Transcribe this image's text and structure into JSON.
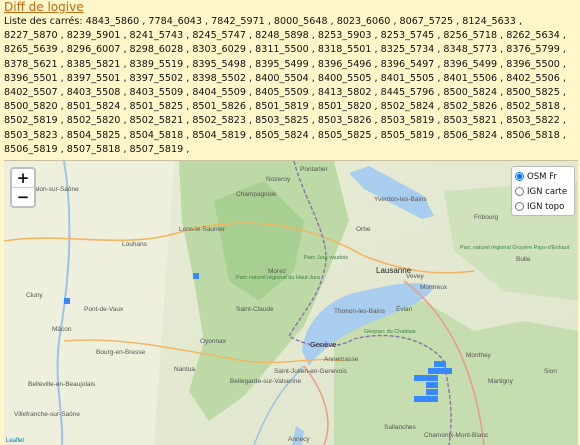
{
  "header": {
    "title": "Diff de logive",
    "list_prefix": "Liste des carrés:",
    "list_text": "Liste des carrés: 4843_5860 , 7784_6043 , 7842_5971 , 8000_5648 , 8023_6060 , 8067_5725 , 8124_5633 , 8227_5870 , 8239_5901 , 8241_5743 , 8245_5747 , 8248_5898 , 8253_5903 , 8253_5745 , 8256_5718 , 8262_5634 , 8265_5639 , 8296_6007 , 8298_6028 , 8303_6029 , 8311_5500 , 8318_5501 , 8325_5734 , 8348_5773 , 8376_5799 , 8378_5621 , 8385_5821 , 8389_5519 , 8395_5498 , 8395_5499 , 8396_5496 , 8396_5497 , 8396_5499 , 8396_5500 , 8396_5501 , 8397_5501 , 8397_5502 , 8398_5502 , 8400_5504 , 8400_5505 , 8401_5505 , 8401_5506 , 8402_5506 , 8402_5507 , 8403_5508 , 8403_5509 , 8404_5509 , 8405_5509 , 8413_5802 , 8445_5796 , 8500_5824 , 8500_5825 , 8500_5820 , 8501_5824 , 8501_5825 , 8501_5826 , 8501_5819 , 8501_5820 , 8502_5824 , 8502_5826 , 8502_5818 , 8502_5819 , 8502_5820 , 8502_5821 , 8502_5823 , 8503_5825 , 8503_5826 , 8503_5819 , 8503_5821 , 8503_5822 , 8503_5823 , 8504_5825 , 8504_5818 , 8504_5819 , 8505_5824 , 8505_5825 , 8505_5819 , 8506_5824 , 8506_5818 , 8506_5819 , 8507_5818 , 8507_5819 ,"
  },
  "map": {
    "zoom_in_label": "+",
    "zoom_out_label": "−",
    "layers": [
      {
        "label": "OSM Fr",
        "selected": true
      },
      {
        "label": "IGN carte",
        "selected": false
      },
      {
        "label": "IGN topo",
        "selected": false
      }
    ],
    "place_labels": [
      "Pontarlier",
      "Lons-le-Saunier",
      "Champagnole",
      "Louhans",
      "Orbe",
      "Yverdon-les-Bains",
      "Fribourg",
      "Lausanne",
      "Vevey",
      "Montreux",
      "Bulle",
      "Thonon-les-Bains",
      "Évian",
      "Genève",
      "Annemasse",
      "Bourg-en-Bresse",
      "Mâcon",
      "Oyonnax",
      "Saint-Claude",
      "Nantua",
      "Bellegarde-sur-Valserine",
      "Annecy",
      "Sallanches",
      "Chamonix-Mont-Blanc",
      "Martigny",
      "Sion",
      "Monthey",
      "Saint-Julien-en-Genevois",
      "Villefranche-sur-Saône",
      "Belleville-en-Beaujolais",
      "Cluny",
      "Pont-de-Vaux",
      "Chalon-sur-Saône",
      "Nozeroy",
      "Morez",
      "Parc naturel régional du Haut-Jura",
      "Parc Jura vaudois",
      "Géoparc du Chablais",
      "Parc naturel régional Gruyère Pays-d'Enhaut"
    ],
    "attribution": "Leaflet"
  },
  "colors": {
    "marker": "#3a88ff",
    "lake": "#a9cdee",
    "border": "#8e6fa6"
  }
}
